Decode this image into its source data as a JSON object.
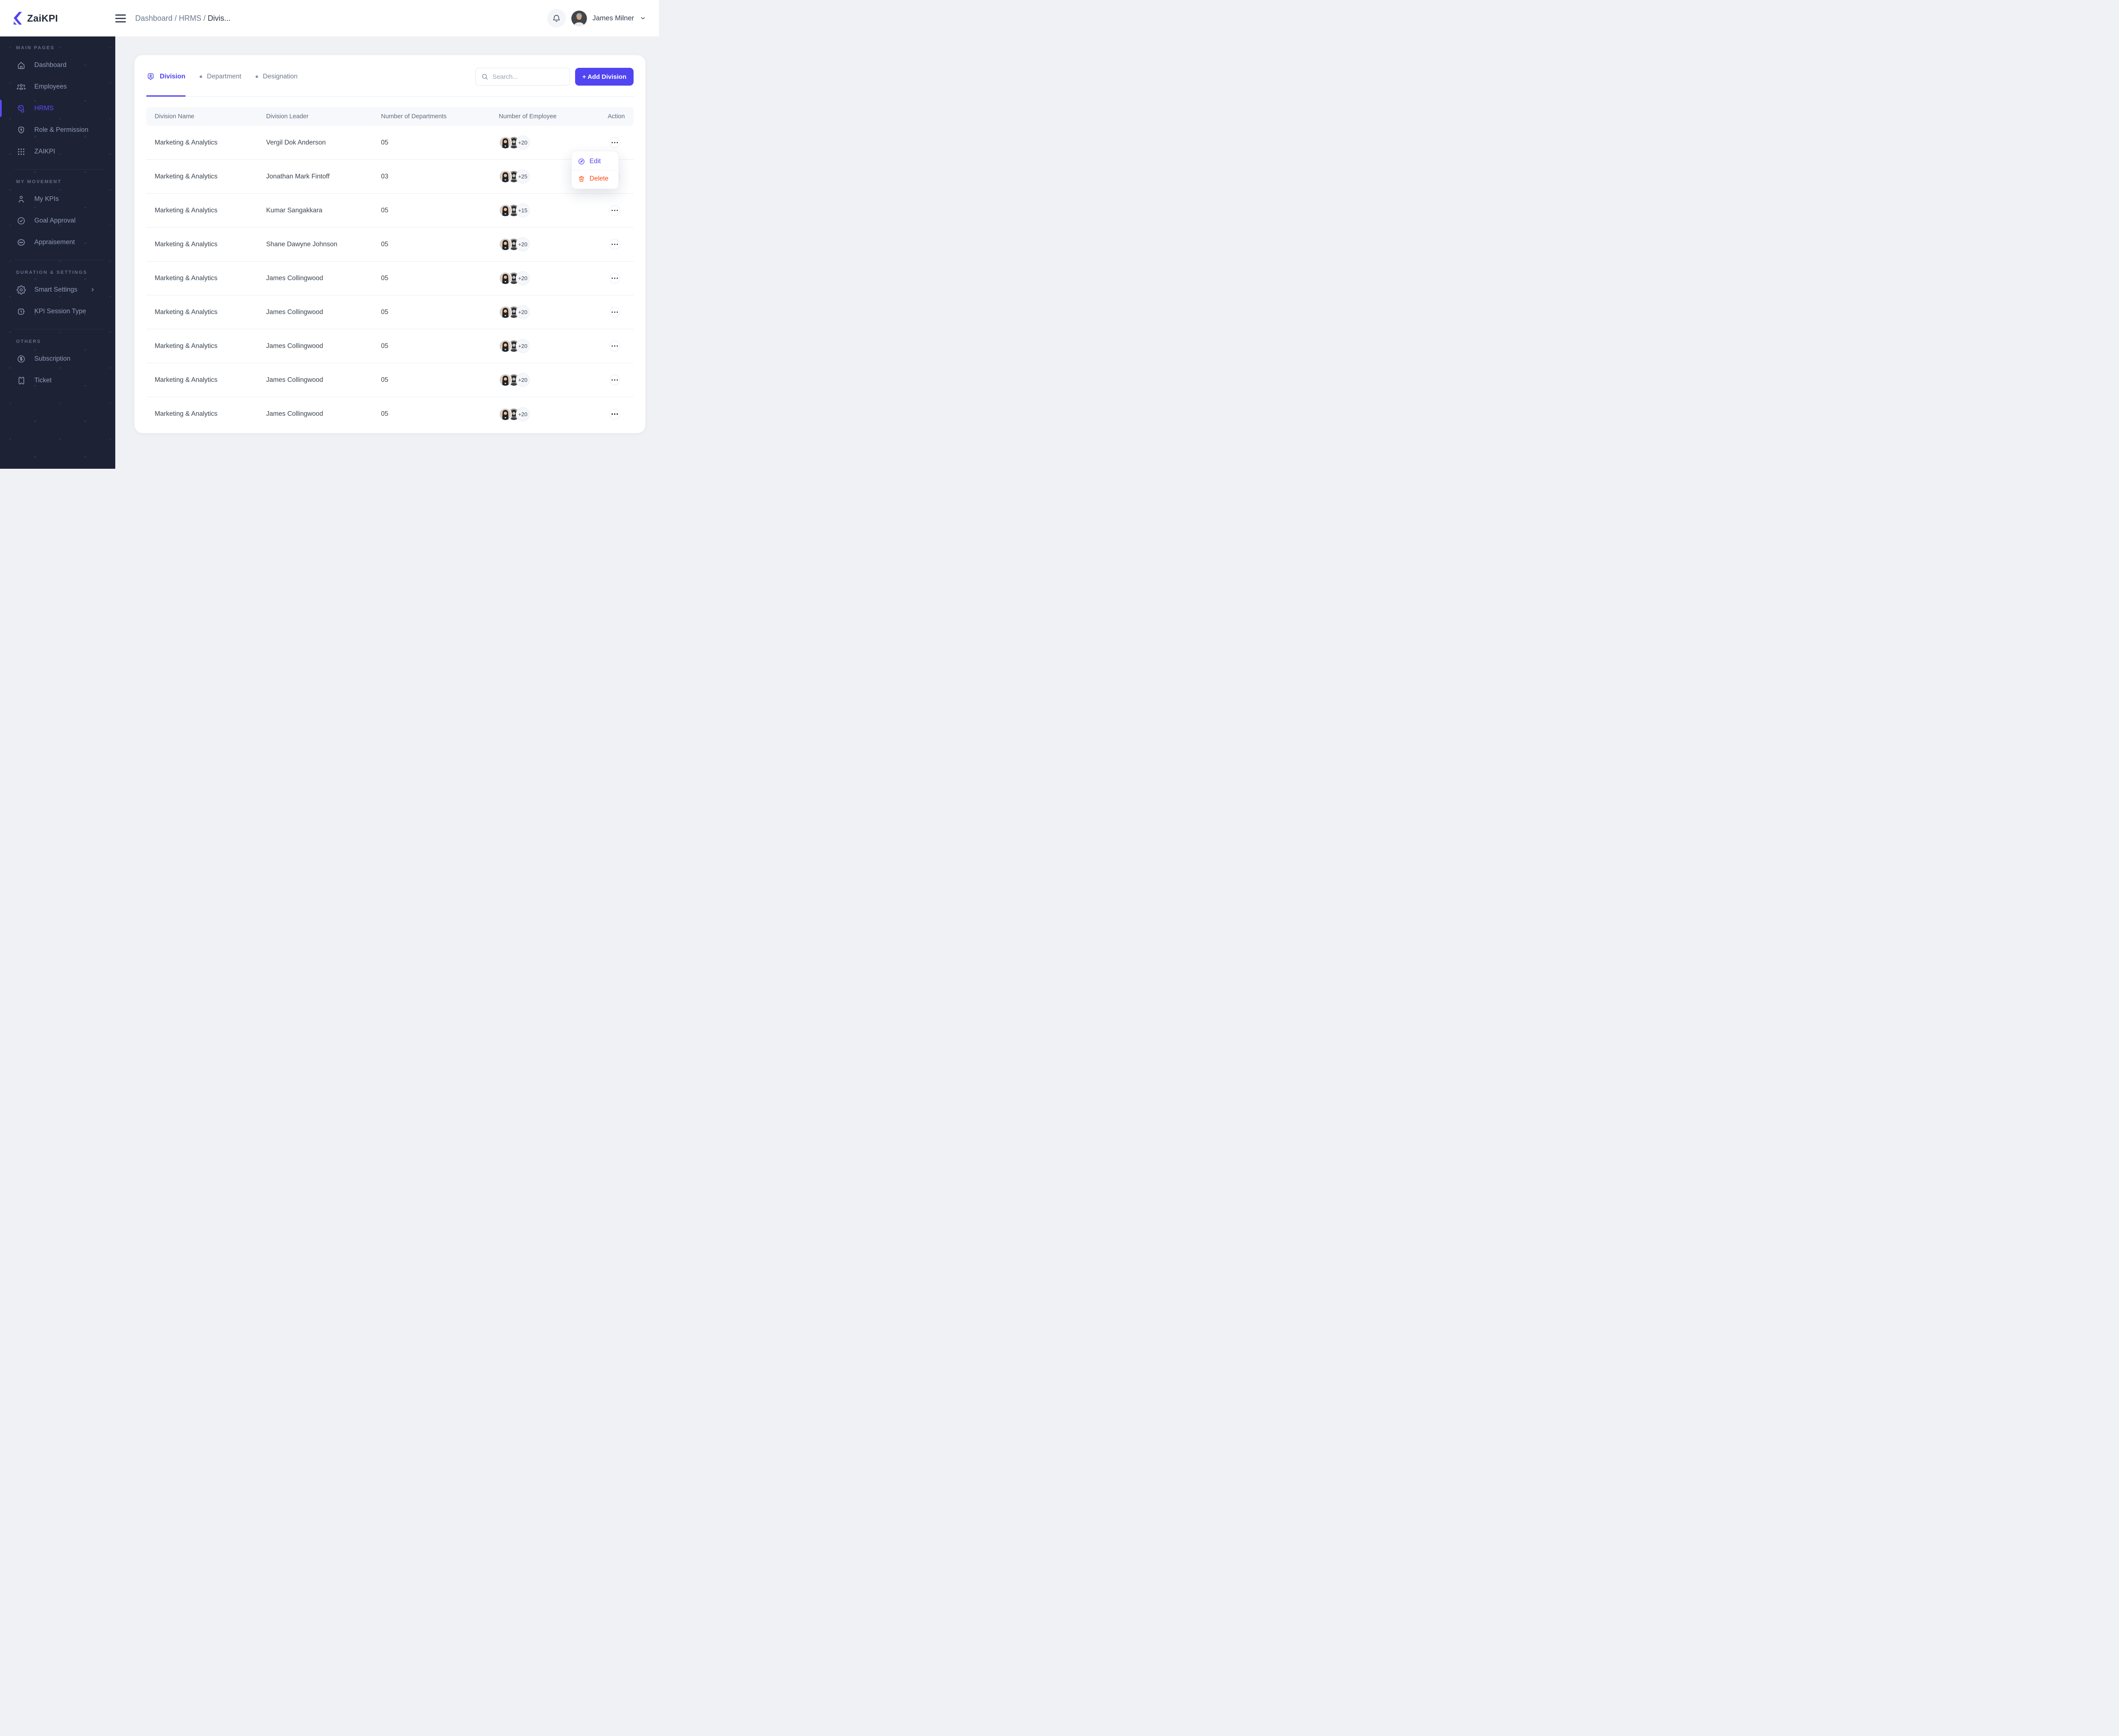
{
  "colors": {
    "accent": "#5145F1",
    "delete": "#FB4A15",
    "sidebar_bg": "#1D2335"
  },
  "header": {
    "logo_text": "ZaiKPI",
    "breadcrumb": {
      "path": "Dashboard / HRMS / ",
      "current": "Divis..."
    },
    "user": {
      "name": "James Milner"
    }
  },
  "sidebar": {
    "sections": [
      {
        "label": "MAIN PAGES",
        "items": [
          {
            "label": "Dashboard",
            "icon": "home-icon"
          },
          {
            "label": "Employees",
            "icon": "people-icon"
          },
          {
            "label": "HRMS",
            "icon": "hrms-tag-icon",
            "active": true
          },
          {
            "label": "Role & Permission",
            "icon": "shield-icon"
          },
          {
            "label": "ZAIKPI",
            "icon": "grid-dots-icon"
          }
        ]
      },
      {
        "label": "MY MOVEMENT",
        "items": [
          {
            "label": "My KPIs",
            "icon": "person-icon"
          },
          {
            "label": "Goal Approval",
            "icon": "check-circle-icon"
          },
          {
            "label": "Appraisement",
            "icon": "pulse-circle-icon"
          }
        ]
      },
      {
        "label": "DURATION & SETTINGS",
        "items": [
          {
            "label": "Smart Settings",
            "icon": "gear-icon",
            "chevron": true
          },
          {
            "label": "KPI Session Type",
            "icon": "clock-icon"
          }
        ]
      },
      {
        "label": "OTHERS",
        "items": [
          {
            "label": "Subscription",
            "icon": "dollar-circle-icon"
          },
          {
            "label": "Ticket",
            "icon": "ticket-icon"
          }
        ]
      }
    ]
  },
  "tabs": [
    {
      "label": "Division",
      "icon": "division-pin-icon",
      "active": true
    },
    {
      "label": "Department",
      "active": false
    },
    {
      "label": "Designation",
      "active": false
    }
  ],
  "toolbar": {
    "search_placeholder": "Search...",
    "add_button_label": "+ Add Division"
  },
  "table": {
    "columns": [
      "Division Name",
      "Division Leader",
      "Number of Departments",
      "Number of Employee",
      "Action"
    ],
    "rows": [
      {
        "division": "Marketing & Analytics",
        "leader": "Vergil Dok Anderson",
        "departments": "05",
        "extra_employees": "+20"
      },
      {
        "division": "Marketing & Analytics",
        "leader": "Jonathan Mark Fintoff",
        "departments": "03",
        "extra_employees": "+25"
      },
      {
        "division": "Marketing & Analytics",
        "leader": "Kumar Sangakkara",
        "departments": "05",
        "extra_employees": "+15"
      },
      {
        "division": "Marketing & Analytics",
        "leader": "Shane Dawyne Johnson",
        "departments": "05",
        "extra_employees": "+20"
      },
      {
        "division": "Marketing & Analytics",
        "leader": "James Collingwood",
        "departments": "05",
        "extra_employees": "+20"
      },
      {
        "division": "Marketing & Analytics",
        "leader": "James Collingwood",
        "departments": "05",
        "extra_employees": "+20"
      },
      {
        "division": "Marketing & Analytics",
        "leader": "James Collingwood",
        "departments": "05",
        "extra_employees": "+20"
      },
      {
        "division": "Marketing & Analytics",
        "leader": "James Collingwood",
        "departments": "05",
        "extra_employees": "+20"
      },
      {
        "division": "Marketing & Analytics",
        "leader": "James Collingwood",
        "departments": "05",
        "extra_employees": "+20"
      }
    ]
  },
  "context_menu": {
    "items": [
      {
        "label": "Edit",
        "icon": "pencil-circle-icon",
        "type": "edit"
      },
      {
        "label": "Delete",
        "icon": "trash-icon",
        "type": "delete"
      }
    ]
  }
}
